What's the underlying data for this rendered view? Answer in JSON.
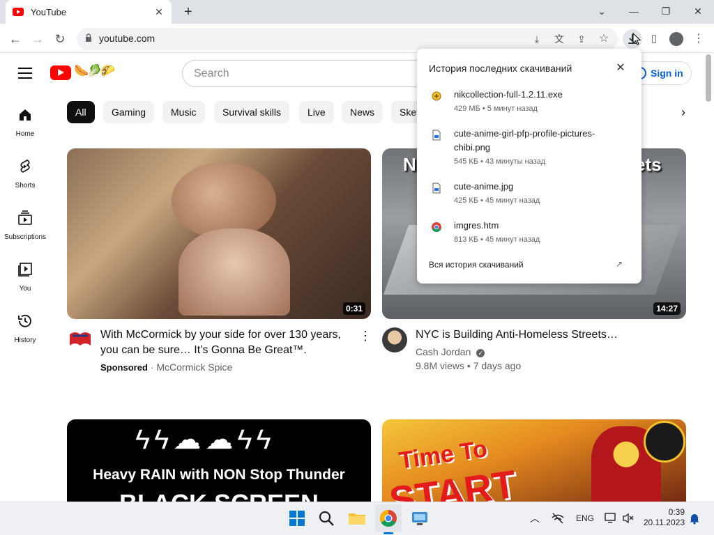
{
  "browser": {
    "tab_title": "YouTube",
    "url": "youtube.com"
  },
  "yt": {
    "search_placeholder": "Search",
    "signin": "Sign in",
    "chips": [
      "All",
      "Gaming",
      "Music",
      "Survival skills",
      "Live",
      "News",
      "Sketch"
    ],
    "sidebar": [
      {
        "label": "Home",
        "icon": "home-icon"
      },
      {
        "label": "Shorts",
        "icon": "shorts-icon"
      },
      {
        "label": "Subscriptions",
        "icon": "subscriptions-icon"
      },
      {
        "label": "You",
        "icon": "you-icon"
      },
      {
        "label": "History",
        "icon": "history-icon"
      }
    ],
    "videos": [
      {
        "title_line1": "With McCormick by your side for over 130 years,",
        "title_line2": "you can be sure… It’s Gonna Be Great™.",
        "sponsored": "Sponsored",
        "channel": "McCormick Spice",
        "duration": "0:31"
      },
      {
        "title_line1": "NYC is Building Anti-Homeless Streets…",
        "channel": "Cash Jordan",
        "meta": "9.8M views • 7 days ago",
        "duration": "14:27",
        "thumb_text_left": "N",
        "thumb_text_right": "ets"
      },
      {
        "thumb_text_line1": "Heavy RAIN with NON Stop Thunder",
        "thumb_text_line2": "BLACK SCREEN"
      },
      {
        "thumb_text_line1": "Time To",
        "thumb_text_line2": "START"
      }
    ]
  },
  "downloads": {
    "heading": "История последних скачиваний",
    "items": [
      {
        "name": "nikcollection-full-1.2.11.exe",
        "meta": "429 МБ • 5 минут назад",
        "icon": "installer-icon"
      },
      {
        "name_line1": "cute-anime-girl-pfp-profile-pictures-",
        "name_line2": "chibi.png",
        "meta": "545 КБ • 43 минуты назад",
        "icon": "image-file-icon"
      },
      {
        "name": "cute-anime.jpg",
        "meta": "425 КБ • 45 минут назад",
        "icon": "image-file-icon"
      },
      {
        "name": "imgres.htm",
        "meta": "813 КБ • 45 минут назад",
        "icon": "chrome-icon"
      }
    ],
    "all_link": "Вся история скачиваний"
  },
  "taskbar": {
    "lang": "ENG",
    "time": "0:39",
    "date": "20.11.2023"
  },
  "colors": {
    "yt_red": "#ff0000",
    "link_blue": "#065fd4",
    "chip_active": "#0f0f0f"
  }
}
